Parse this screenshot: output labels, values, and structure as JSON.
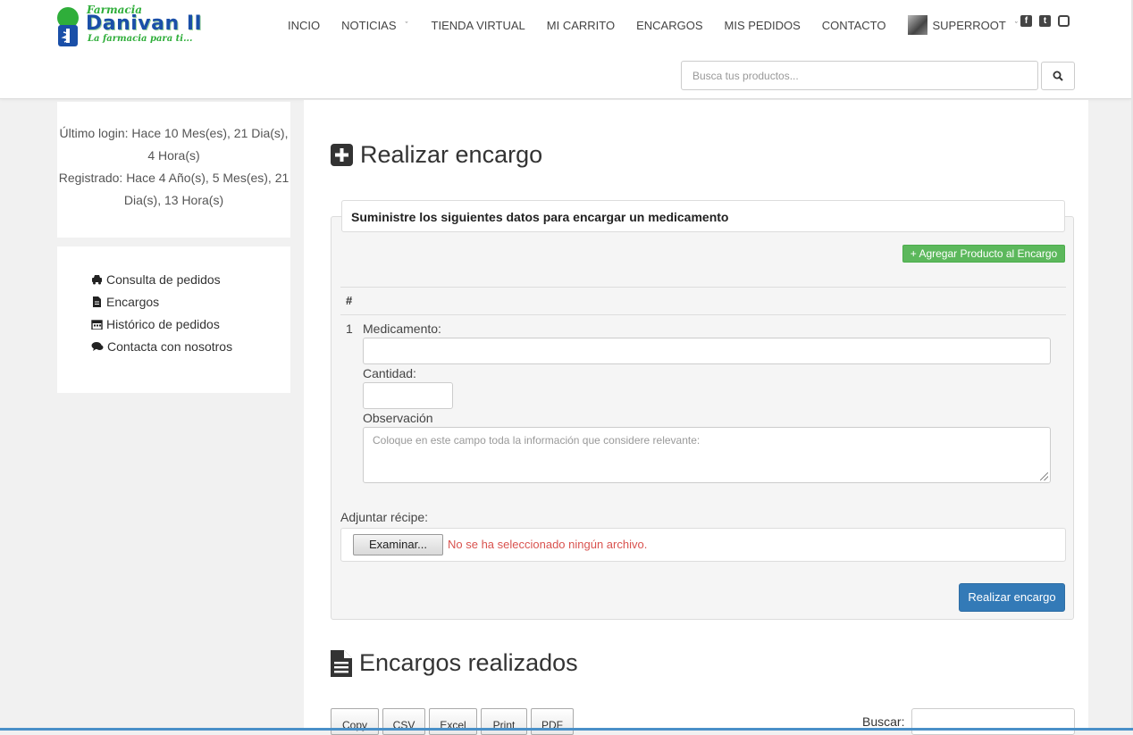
{
  "brand": {
    "top": "Farmacia",
    "name": "Danivan II",
    "tagline": "La farmacia para ti..."
  },
  "nav": {
    "items": [
      {
        "label": "INCIO"
      },
      {
        "label": "NOTICIAS"
      },
      {
        "label": "TIENDA VIRTUAL"
      },
      {
        "label": "MI CARRITO"
      },
      {
        "label": "ENCARGOS"
      },
      {
        "label": "MIS PEDIDOS"
      },
      {
        "label": "CONTACTO"
      },
      {
        "label": "SUPERROOT"
      }
    ],
    "social": [
      "facebook-icon",
      "twitter-icon",
      "instagram-icon"
    ]
  },
  "search": {
    "placeholder": "Busca tus productos..."
  },
  "sidebar": {
    "last_login": "Último login: Hace 10 Mes(es), 21 Dia(s), 4 Hora(s)",
    "registered": "Registrado: Hace 4 Año(s), 5 Mes(es), 21 Dia(s), 13 Hora(s)",
    "menu": [
      {
        "label": "Consulta de pedidos",
        "icon": "car-icon"
      },
      {
        "label": "Encargos",
        "icon": "file-icon"
      },
      {
        "label": "Histórico de pedidos",
        "icon": "calendar-icon"
      },
      {
        "label": "Contacta con nosotros",
        "icon": "comments-icon"
      }
    ]
  },
  "order_form": {
    "title": "Realizar encargo",
    "panel_heading": "Suministre los siguientes datos para encargar un medicamento",
    "add_button": "+ Agregar Producto al Encargo",
    "table_header": "#",
    "row_number": "1",
    "medicamento_label": "Medicamento:",
    "cantidad_label": "Cantidad:",
    "observacion_label": "Observación",
    "observacion_placeholder": "Coloque en este campo toda la información que considere relevante:",
    "recipe_label": "Adjuntar récipe:",
    "file_button": "Examinar...",
    "file_status": "No se ha seleccionado ningún archivo.",
    "submit_button": "Realizar encargo"
  },
  "orders_done": {
    "title": "Encargos realizados",
    "buttons": [
      "Copy",
      "CSV",
      "Excel",
      "Print",
      "PDF"
    ],
    "search_label": "Buscar:"
  },
  "colors": {
    "accent_blue": "#337ab7",
    "accent_green": "#5cb85c",
    "error_red": "#d9534f"
  }
}
